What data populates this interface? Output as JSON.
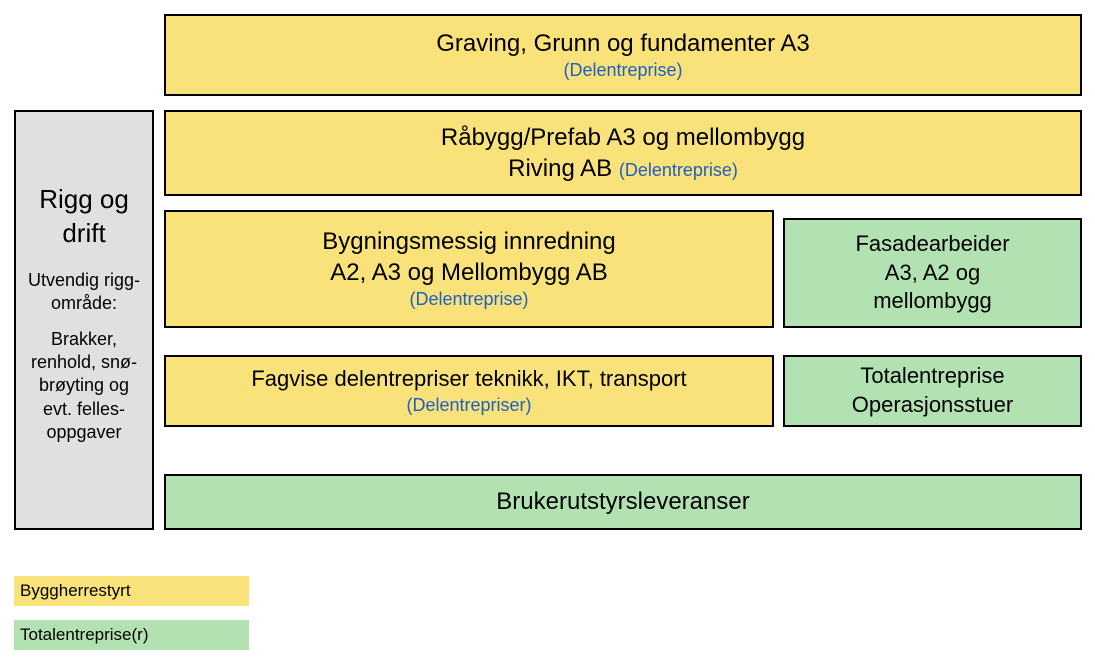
{
  "sidebar": {
    "title_line1": "Rigg og",
    "title_line2": "drift",
    "subtext": "Utvendig rigg-område:",
    "detail": "Brakker, renhold, snø-brøyting og evt. felles-oppgaver"
  },
  "boxes": {
    "row1": {
      "title": "Graving, Grunn og fundamenter A3",
      "sub": "(Delentreprise)"
    },
    "row2": {
      "line1": "Råbygg/Prefab A3 og mellombygg",
      "line2a": "Riving AB",
      "line2b": "(Delentreprise)"
    },
    "row3a": {
      "line1": "Bygningsmessig innredning",
      "line2": "A2, A3 og Mellombygg AB",
      "sub": "(Delentreprise)"
    },
    "row3b": {
      "line1": "Fasadearbeider",
      "line2": "A3, A2 og",
      "line3": "mellombygg"
    },
    "row4a": {
      "title": "Fagvise delentrepriser teknikk, IKT, transport",
      "sub": "(Delentrepriser)"
    },
    "row4b": {
      "line1": "Totalentreprise",
      "line2": "Operasjonsstuer"
    },
    "row5": {
      "title": "Brukerutstyrsleveranser"
    }
  },
  "legend": {
    "item1": "Byggherrestyrt",
    "item2": "Totalentreprise(r)"
  }
}
